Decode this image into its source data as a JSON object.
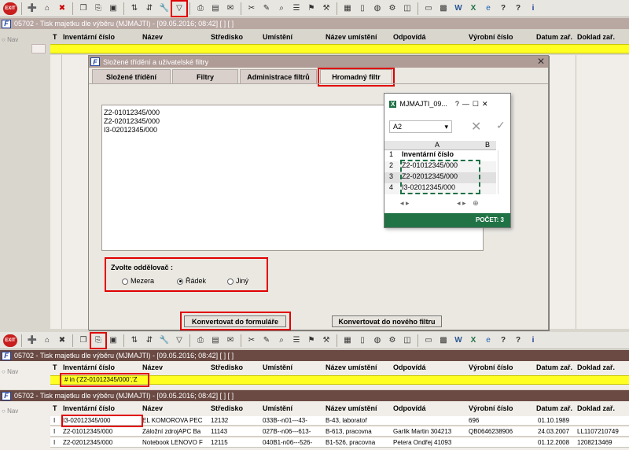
{
  "top_toolbar": {
    "exit": "EXIT"
  },
  "background_window": {
    "title": "05702 - Tisk majetku dle výběru (MJMAJTI) - [09.05.2016; 08:42]  [ ]  [ ]",
    "nav": "Nav",
    "columns": {
      "t": "T",
      "inv": "Inventární číslo",
      "nazev": "Název",
      "stredisko": "Středisko",
      "umisteni": "Umístění",
      "nazev_umisteni": "Název umístění",
      "odpovida": "Odpovídá",
      "vyrobni": "Výrobní číslo",
      "datum": "Datum zař.",
      "doklad": "Doklad zař."
    }
  },
  "dialog": {
    "title": "Složené třídění a uživatelské filtry",
    "tabs": [
      "Složené třídění",
      "Filtry",
      "Administrace filtrů",
      "Hromadný filtr"
    ],
    "lines": [
      "Z2-01012345/000",
      "Z2-02012345/000",
      "I3-02012345/000"
    ],
    "separator_label": "Zvolte oddělovač :",
    "options": [
      "Mezera",
      "Řádek",
      "Jiný"
    ],
    "selected_option": "Řádek",
    "btn_convert_form": "Konvertovat do formuláře",
    "btn_convert_filter": "Konvertovat do nového filtru"
  },
  "excel": {
    "title": "MJMAJTI_09...",
    "help": "?",
    "cell_ref": "A2",
    "col_a": "A",
    "col_b": "B",
    "rows": [
      {
        "n": "1",
        "v": "Inventární číslo"
      },
      {
        "n": "2",
        "v": "Z2-01012345/000"
      },
      {
        "n": "3",
        "v": "Z2-02012345/000"
      },
      {
        "n": "4",
        "v": "I3-02012345/000"
      }
    ],
    "status": "POČET: 3"
  },
  "bottom_window1": {
    "title": "05702 - Tisk majetku dle výběru (MJMAJTI) - [09.05.2016; 08:42]  [ ]  [ ]",
    "nav": "Nav",
    "filter_value": "# in ('Z2-01012345/000','Z"
  },
  "bottom_window2": {
    "title": "05702 - Tisk majetku dle výběru (MJMAJTI) - [09.05.2016; 08:42]  [ ]  [ ]",
    "nav": "Nav",
    "rows": [
      {
        "t": "I",
        "inv": "I3-02012345/000",
        "nazev": "EL KOMOROVA PEC",
        "stredisko": "12132",
        "umisteni": "033B--n01---43-",
        "nazev_umisteni": "B-43, laboratoř",
        "odpovida": "",
        "vyrobni": "696",
        "datum": "01.10.1989",
        "doklad": ""
      },
      {
        "t": "I",
        "inv": "Z2-01012345/000",
        "nazev": "Záložní zdrojAPC Ba",
        "stredisko": "11143",
        "umisteni": "027B--n06---613-",
        "nazev_umisteni": "B-613, pracovna",
        "odpovida": "Garlik Martin 304213",
        "vyrobni": "QB0646238906",
        "datum": "24.03.2007",
        "doklad": "LL1107210749"
      },
      {
        "t": "I",
        "inv": "Z2-02012345/000",
        "nazev": "Notebook LENOVO F",
        "stredisko": "12115",
        "umisteni": "040B1-n06---526-",
        "nazev_umisteni": "B1-526, pracovna",
        "odpovida": "Petera Ondřej 41093",
        "vyrobni": "",
        "datum": "01.12.2008",
        "doklad": "1208213469"
      }
    ]
  }
}
